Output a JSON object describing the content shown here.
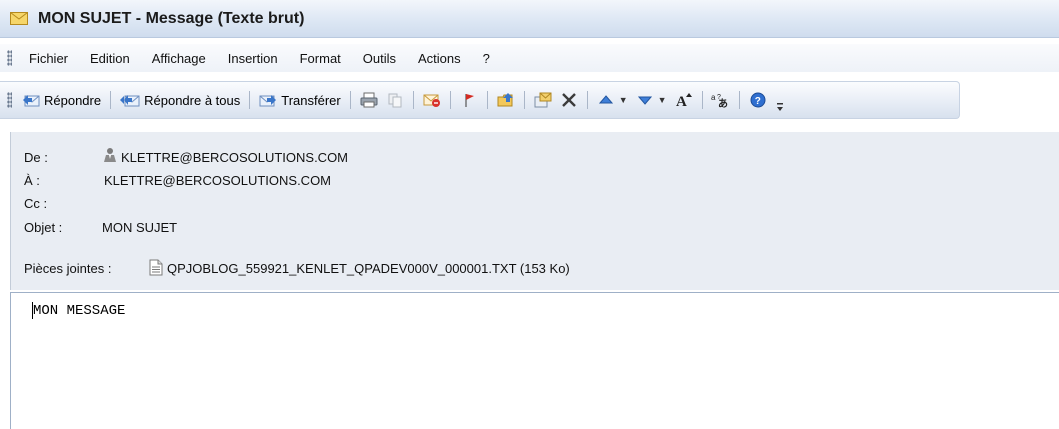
{
  "window": {
    "title": "MON SUJET - Message (Texte brut)",
    "icon": "envelope-icon"
  },
  "menu": [
    {
      "label": "Fichier",
      "accel": "F"
    },
    {
      "label": "Edition",
      "accel": "E"
    },
    {
      "label": "Affichage",
      "accel": "A"
    },
    {
      "label": "Insertion",
      "accel": "I"
    },
    {
      "label": "Format",
      "accel": "t"
    },
    {
      "label": "Outils",
      "accel": "O"
    },
    {
      "label": "Actions",
      "accel": "s"
    },
    {
      "label": "?",
      "accel": "?"
    }
  ],
  "toolbar": {
    "reply": "Répondre",
    "reply_all": "Répondre à tous",
    "forward": "Transférer"
  },
  "header": {
    "from_label": "De :",
    "from_value": "KLETTRE@BERCOSOLUTIONS.COM",
    "to_label": "À :",
    "to_value": "KLETTRE@BERCOSOLUTIONS.COM",
    "cc_label": "Cc :",
    "cc_value": "",
    "subject_label": "Objet :",
    "subject_value": "MON SUJET",
    "attachments_label": "Pièces jointes :",
    "attachment_name": "QPJOBLOG_559921_KENLET_QPADEV000V_000001.TXT (153 Ko)"
  },
  "body": {
    "text": "MON MESSAGE"
  },
  "colors": {
    "header_bg": "#e9edf3",
    "toolbar_bg": "#e6ecf5",
    "accent_blue": "#2f5fa8"
  }
}
